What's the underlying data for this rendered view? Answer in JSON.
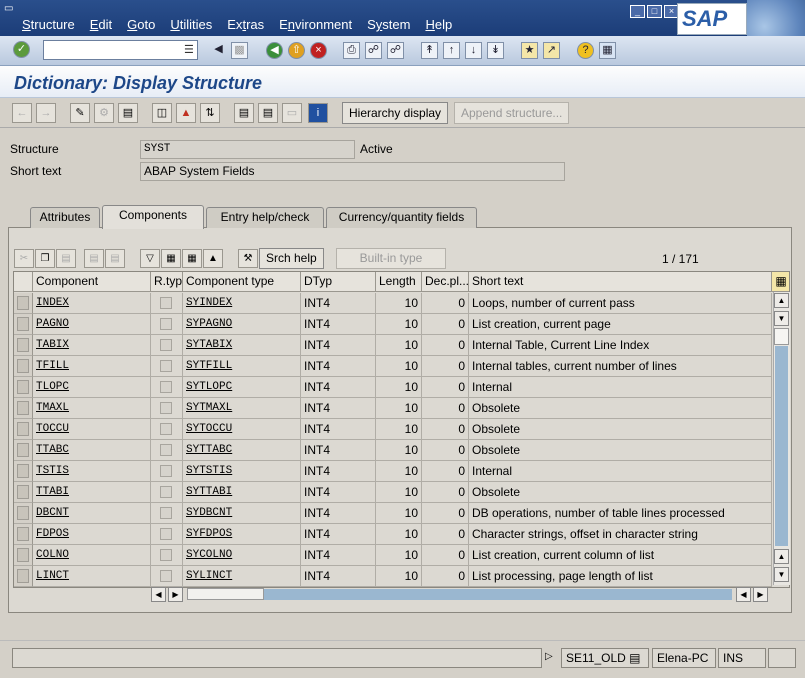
{
  "menu": {
    "items": [
      "Structure",
      "Edit",
      "Goto",
      "Utilities",
      "Extras",
      "Environment",
      "System",
      "Help"
    ],
    "underline": [
      "S",
      "E",
      "G",
      "U",
      "t",
      "n",
      "y",
      "H"
    ]
  },
  "logo": "SAP",
  "page_title": "Dictionary: Display Structure",
  "app_toolbar": {
    "hierarchy_display": "Hierarchy display",
    "append_structure": "Append structure..."
  },
  "header": {
    "structure_label": "Structure",
    "structure_value": "SYST",
    "status": "Active",
    "short_text_label": "Short text",
    "short_text_value": "ABAP System Fields"
  },
  "tabs": [
    "Attributes",
    "Components",
    "Entry help/check",
    "Currency/quantity fields"
  ],
  "active_tab": "Components",
  "table_toolbar": {
    "srch_help": "Srch help",
    "built_in_type": "Built-in type",
    "page_info": "1 / 171"
  },
  "table": {
    "headers": [
      "Component",
      "R.typ",
      "Component type",
      "DTyp",
      "Length",
      "Dec.pl...",
      "Short text"
    ],
    "rows": [
      {
        "component": "INDEX",
        "type": "SYINDEX",
        "dtyp": "INT4",
        "length": "10",
        "dec": "0",
        "text": "Loops, number of current pass"
      },
      {
        "component": "PAGNO",
        "type": "SYPAGNO",
        "dtyp": "INT4",
        "length": "10",
        "dec": "0",
        "text": "List creation, current page"
      },
      {
        "component": "TABIX",
        "type": "SYTABIX",
        "dtyp": "INT4",
        "length": "10",
        "dec": "0",
        "text": "Internal Table, Current Line Index"
      },
      {
        "component": "TFILL",
        "type": "SYTFILL",
        "dtyp": "INT4",
        "length": "10",
        "dec": "0",
        "text": "Internal tables, current number of lines"
      },
      {
        "component": "TLOPC",
        "type": "SYTLOPC",
        "dtyp": "INT4",
        "length": "10",
        "dec": "0",
        "text": "Internal"
      },
      {
        "component": "TMAXL",
        "type": "SYTMAXL",
        "dtyp": "INT4",
        "length": "10",
        "dec": "0",
        "text": "Obsolete"
      },
      {
        "component": "TOCCU",
        "type": "SYTOCCU",
        "dtyp": "INT4",
        "length": "10",
        "dec": "0",
        "text": "Obsolete"
      },
      {
        "component": "TTABC",
        "type": "SYTTABC",
        "dtyp": "INT4",
        "length": "10",
        "dec": "0",
        "text": "Obsolete"
      },
      {
        "component": "TSTIS",
        "type": "SYTSTIS",
        "dtyp": "INT4",
        "length": "10",
        "dec": "0",
        "text": "Internal"
      },
      {
        "component": "TTABI",
        "type": "SYTTABI",
        "dtyp": "INT4",
        "length": "10",
        "dec": "0",
        "text": "Obsolete"
      },
      {
        "component": "DBCNT",
        "type": "SYDBCNT",
        "dtyp": "INT4",
        "length": "10",
        "dec": "0",
        "text": "DB operations, number of table lines processed"
      },
      {
        "component": "FDPOS",
        "type": "SYFDPOS",
        "dtyp": "INT4",
        "length": "10",
        "dec": "0",
        "text": "Character strings, offset in character string"
      },
      {
        "component": "COLNO",
        "type": "SYCOLNO",
        "dtyp": "INT4",
        "length": "10",
        "dec": "0",
        "text": "List creation, current column of list"
      },
      {
        "component": "LINCT",
        "type": "SYLINCT",
        "dtyp": "INT4",
        "length": "10",
        "dec": "0",
        "text": "List processing, page length of list"
      }
    ]
  },
  "status_bar": {
    "transaction": "SE11_OLD",
    "host": "Elena-PC",
    "mode": "INS"
  },
  "colors": {
    "menubar": "#1c3d78",
    "title": "#1d4788",
    "scroll_track": "#9ab7d0"
  }
}
